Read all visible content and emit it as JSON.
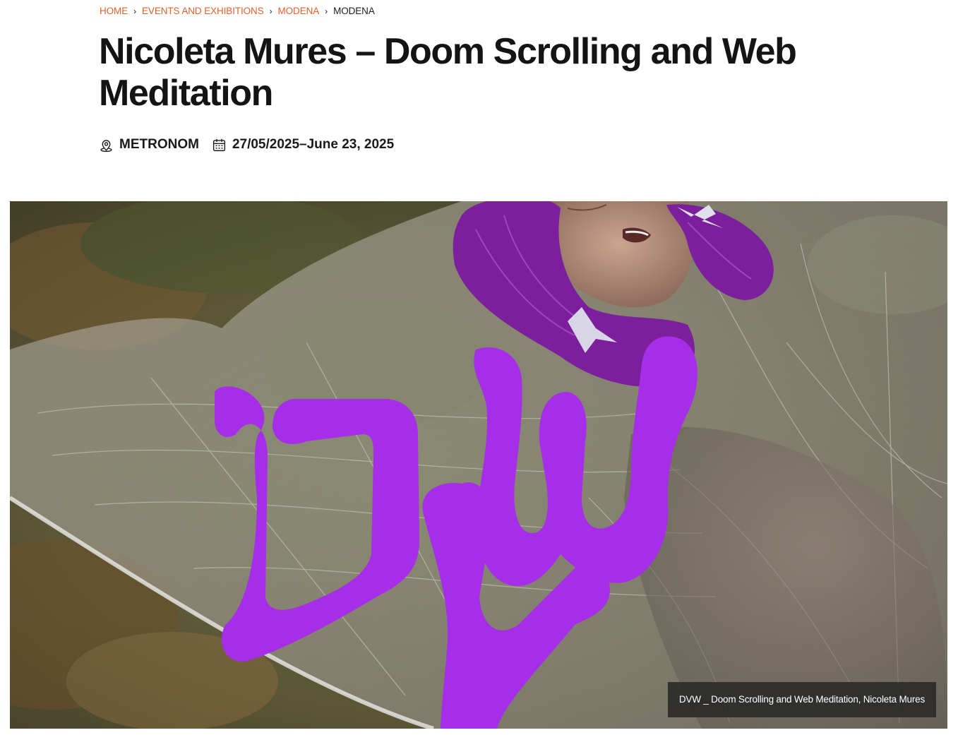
{
  "breadcrumb": {
    "home": "HOME",
    "events": "EVENTS AND EXHIBITIONS",
    "city_link": "MODENA",
    "current": "MODENA",
    "separator": "›"
  },
  "title": "Nicoleta Mures – Doom Scrolling and Web Meditation",
  "meta": {
    "venue": "METRONOM",
    "dates": "27/05/2025–June 23, 2025",
    "venue_icon": "location-pin-icon",
    "date_icon": "calendar-icon"
  },
  "hero": {
    "caption": "DVW _ Doom Scrolling and Web Meditation, Nicoleta Mures",
    "logo_letters": "DVW"
  },
  "colors": {
    "accent": "#e0622c",
    "text": "#141414",
    "logo_purple": "#a62ee8",
    "hair_purple": "#7b1f9c"
  }
}
